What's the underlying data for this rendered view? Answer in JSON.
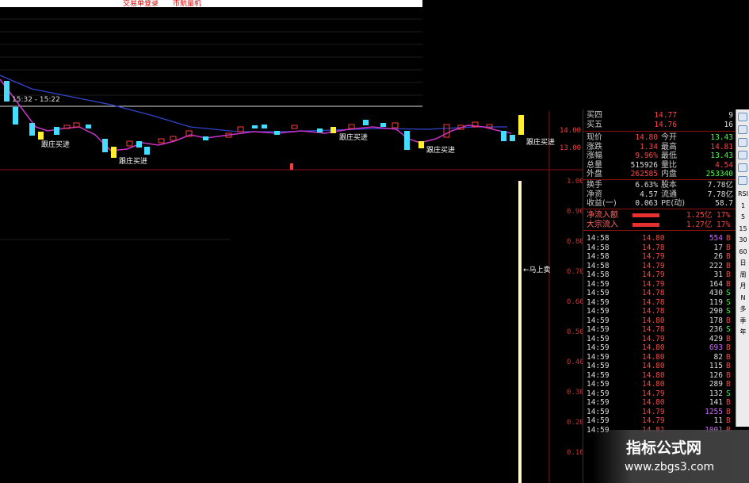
{
  "menu": {
    "item1": "交易单登录",
    "item2": "市航量机"
  },
  "chart": {
    "time_label": "15:32 - 15:22",
    "annotations": [
      "跟庄买进",
      "跟庄买进",
      "跟庄买进",
      "跟庄买进",
      "跟庄买进"
    ],
    "marker_label": "←马上卖",
    "price_axis": [
      "14.00",
      "13.00"
    ],
    "indicator_axis": [
      "1.00",
      "0.90",
      "0.80",
      "0.70",
      "0.60",
      "0.50",
      "0.40",
      "0.30",
      "0.20",
      "0.10"
    ],
    "colors": {
      "up": "#ff3b3b",
      "down": "#44ddff",
      "signal": "#ffee33",
      "ma1": "#cc33cc",
      "ma2": "#3344cc",
      "axis": "#8b1010"
    }
  },
  "quote": {
    "sell4": {
      "label": "买四",
      "price": "14.77",
      "volume": "9"
    },
    "sell5": {
      "label": "买五",
      "price": "14.76",
      "volume": "16"
    },
    "rows": [
      {
        "l1": "现价",
        "v1": "14.80",
        "c1": "#ff4444",
        "l2": "今开",
        "v2": "13.43",
        "c2": "#44ff44"
      },
      {
        "l1": "涨跌",
        "v1": "1.34",
        "c1": "#ff4444",
        "l2": "最高",
        "v2": "14.81",
        "c2": "#ff4444"
      },
      {
        "l1": "涨幅",
        "v1": "9.96%",
        "c1": "#ff4444",
        "l2": "最低",
        "v2": "13.43",
        "c2": "#44ff44"
      },
      {
        "l1": "总量",
        "v1": "515926",
        "c1": "#dddddd",
        "l2": "量比",
        "v2": "4.54",
        "c2": "#ff4444"
      },
      {
        "l1": "外盘",
        "v1": "262585",
        "c1": "#ff4444",
        "l2": "内盘",
        "v2": "253340",
        "c2": "#44ff44"
      }
    ],
    "rows2": [
      {
        "l1": "换手",
        "v1": "6.63%",
        "l2": "股本",
        "v2": "7.78亿"
      },
      {
        "l1": "净资",
        "v1": "4.57",
        "l2": "流通",
        "v2": "7.78亿"
      },
      {
        "l1": "收益(一)",
        "v1": "0.063",
        "l2": "PE(动)",
        "v2": "58.7"
      }
    ],
    "flows": [
      {
        "label": "净流入额",
        "value": "1.25亿",
        "pct": "17%"
      },
      {
        "label": "大宗流入",
        "value": "1.27亿",
        "pct": "17%"
      }
    ]
  },
  "ticks": [
    {
      "t": "14:58",
      "p": "14.80",
      "v": "554",
      "d": "B"
    },
    {
      "t": "14:58",
      "p": "14.78",
      "v": "17",
      "d": "B"
    },
    {
      "t": "14:58",
      "p": "14.79",
      "v": "26",
      "d": "B"
    },
    {
      "t": "14:58",
      "p": "14.79",
      "v": "222",
      "d": "B"
    },
    {
      "t": "14:58",
      "p": "14.79",
      "v": "31",
      "d": "B"
    },
    {
      "t": "14:59",
      "p": "14.79",
      "v": "164",
      "d": "B"
    },
    {
      "t": "14:59",
      "p": "14.78",
      "v": "430",
      "d": "S"
    },
    {
      "t": "14:59",
      "p": "14.78",
      "v": "119",
      "d": "S"
    },
    {
      "t": "14:59",
      "p": "14.78",
      "v": "290",
      "d": "S"
    },
    {
      "t": "14:59",
      "p": "14.80",
      "v": "178",
      "d": "B"
    },
    {
      "t": "14:59",
      "p": "14.78",
      "v": "236",
      "d": "S"
    },
    {
      "t": "14:59",
      "p": "14.79",
      "v": "429",
      "d": "B"
    },
    {
      "t": "14:59",
      "p": "14.80",
      "v": "693",
      "d": "B"
    },
    {
      "t": "14:59",
      "p": "14.80",
      "v": "82",
      "d": "B"
    },
    {
      "t": "14:59",
      "p": "14.80",
      "v": "115",
      "d": "B"
    },
    {
      "t": "14:59",
      "p": "14.80",
      "v": "126",
      "d": "B"
    },
    {
      "t": "14:59",
      "p": "14.80",
      "v": "289",
      "d": "B"
    },
    {
      "t": "14:59",
      "p": "14.79",
      "v": "132",
      "d": "S"
    },
    {
      "t": "14:59",
      "p": "14.80",
      "v": "141",
      "d": "B"
    },
    {
      "t": "14:59",
      "p": "14.79",
      "v": "1255",
      "d": "B"
    },
    {
      "t": "14:59",
      "p": "14.79",
      "v": "11",
      "d": "B"
    },
    {
      "t": "14:59",
      "p": "14.81",
      "v": "1001",
      "d": "B"
    }
  ],
  "tools": [
    "RSI",
    "1",
    "5",
    "15",
    "30",
    "60",
    "日",
    "周",
    "月",
    "N",
    "多",
    "季",
    "年"
  ],
  "watermark": {
    "title": "指标公式网",
    "url": "www.zbgs3.com"
  }
}
